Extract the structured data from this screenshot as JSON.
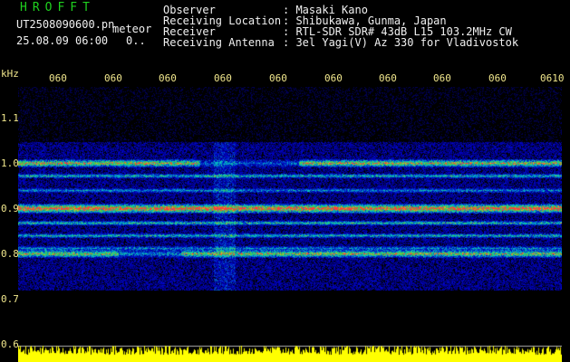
{
  "header": {
    "app_name": "HROFFT",
    "file_name": "UT2508090600.pn",
    "mode_label": "meteor",
    "date_time": "25.08.09 06:00",
    "count_value": "0.."
  },
  "station_info": [
    {
      "key": "Observer",
      "value": ": Masaki Kano"
    },
    {
      "key": "Receiving Location",
      "value": ": Shibukawa, Gunma, Japan"
    },
    {
      "key": "Receiver",
      "value": ": RTL-SDR SDR# 43dB L15 103.2MHz CW"
    },
    {
      "key": "Receiving Antenna",
      "value": ": 3el Yagi(V) Az 330 for Vladivostok"
    }
  ],
  "y_axis": {
    "unit": "kHz",
    "ticks": [
      "1.1",
      "1.0",
      "0.9",
      "0.8",
      "0.7",
      "0.6"
    ]
  },
  "x_axis": {
    "ticks": [
      "060",
      "060",
      "060",
      "060",
      "060",
      "060",
      "060",
      "060",
      "060",
      "0610"
    ]
  },
  "colors": {
    "background": "#000000",
    "axis_text": "#f0e68c",
    "header_green": "#1fd11f",
    "power_strip": "#ffff00"
  }
}
